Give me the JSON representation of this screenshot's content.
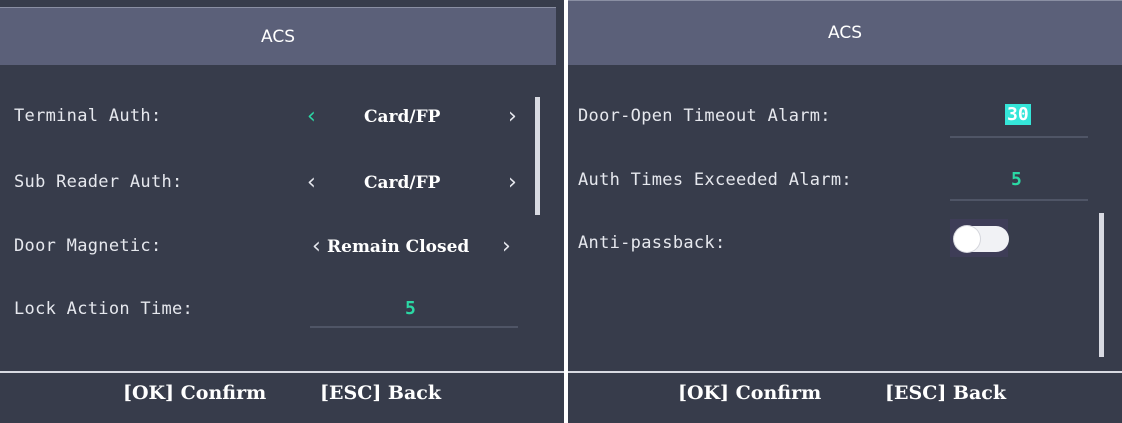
{
  "left_screen": {
    "title": "ACS",
    "rows": [
      {
        "label": "Terminal Auth:",
        "value": "Card/FP",
        "left_arrow": "‹",
        "right_arrow": "›"
      },
      {
        "label": "Sub Reader Auth:",
        "value": "Card/FP",
        "left_arrow": "‹",
        "right_arrow": "›"
      },
      {
        "label": "Door Magnetic:",
        "value": "Remain Closed",
        "left_arrow": "‹",
        "right_arrow": "›"
      },
      {
        "label": "Lock Action Time:",
        "value": "5"
      }
    ],
    "footer": {
      "confirm": "[OK] Confirm",
      "back": "[ESC] Back"
    }
  },
  "right_screen": {
    "title": "ACS",
    "rows": [
      {
        "label": "Door-Open Timeout Alarm:",
        "value": "30"
      },
      {
        "label": "Auth Times Exceeded Alarm:",
        "value": "5"
      },
      {
        "label": "Anti-passback:",
        "toggle": "off"
      }
    ],
    "footer": {
      "confirm": "[OK] Confirm",
      "back": "[ESC] Back"
    }
  },
  "colors": {
    "background": "#373c4b",
    "title_bar": "#5b6079",
    "accent": "#2bd8a4",
    "selected_field": "#35e6d9"
  }
}
